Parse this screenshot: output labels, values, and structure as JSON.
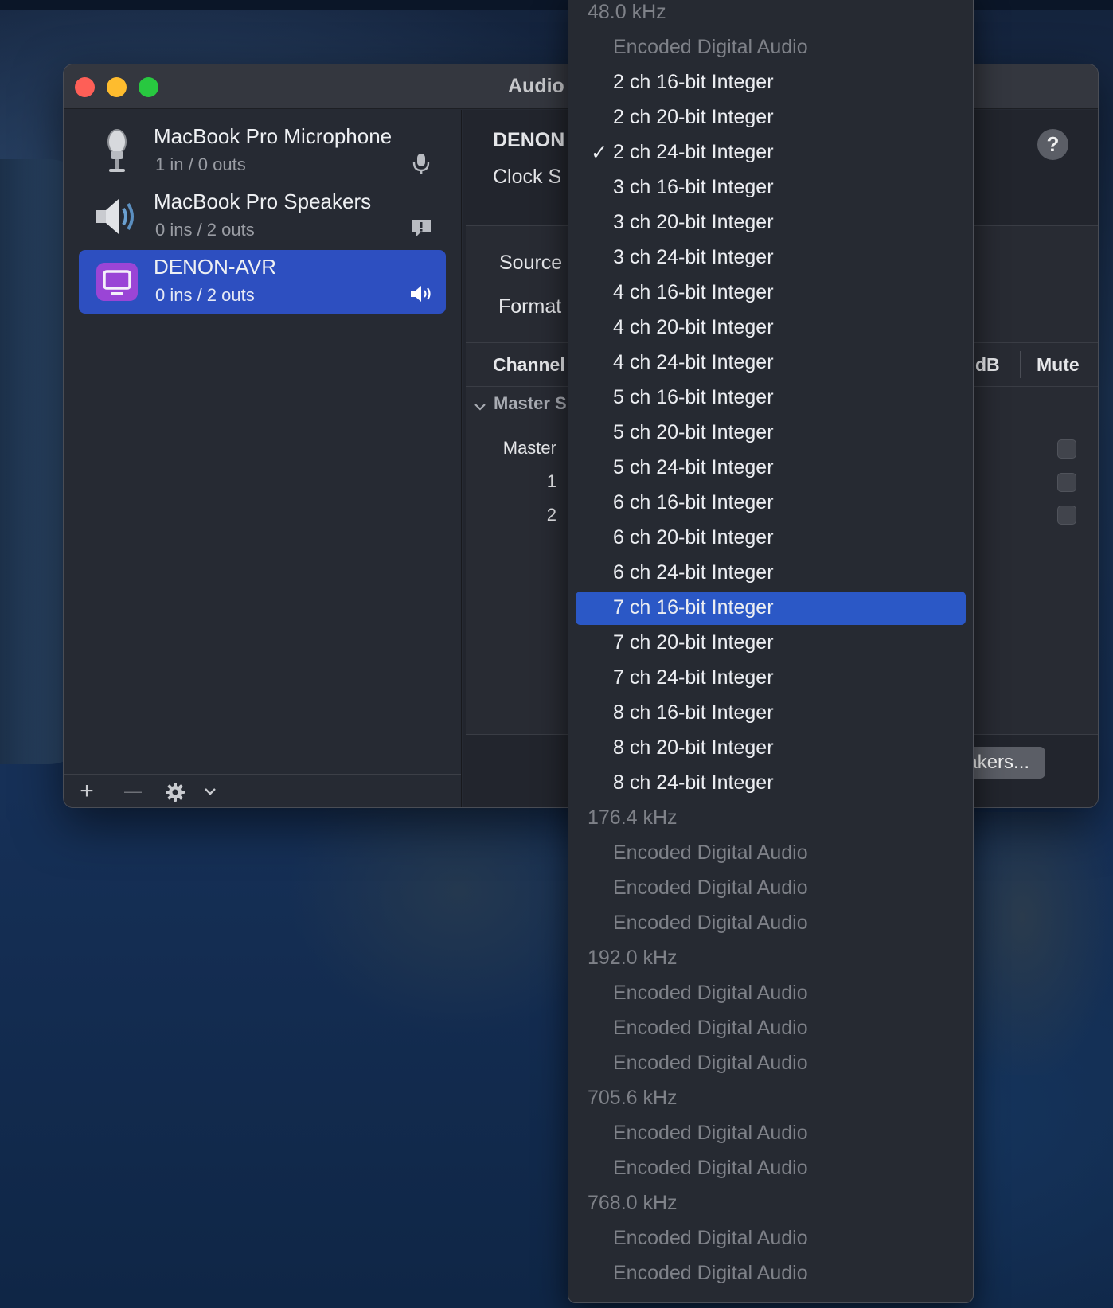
{
  "window": {
    "title": "Audio"
  },
  "sidebar": {
    "devices": [
      {
        "name": "MacBook Pro Microphone",
        "io": "1 in / 0 outs",
        "icon": "microphone-icon",
        "badge": "mic-input-icon"
      },
      {
        "name": "MacBook Pro Speakers",
        "io": "0 ins / 2 outs",
        "icon": "speaker-icon",
        "badge": "alert-bubble-icon"
      },
      {
        "name": "DENON-AVR",
        "io": "0 ins / 2 outs",
        "icon": "display-device-icon",
        "badge": "volume-icon",
        "selected": true
      }
    ],
    "footer": {
      "add": "+",
      "remove": "—"
    }
  },
  "detail": {
    "device_title": "DENON",
    "clock_label": "Clock S",
    "help": "?",
    "source_label": "Source",
    "format_label": "Format",
    "table": {
      "channel_header": "Channel",
      "db_header": "dB",
      "mute_header": "Mute",
      "group": "Master S",
      "rows": [
        "Master",
        "1",
        "2"
      ]
    },
    "configure_button": "eakers..."
  },
  "format_menu": {
    "colors": {
      "selected_bg": "#2b58c6",
      "disabled_text": "#7e8188"
    },
    "items": [
      {
        "text": "48.0 kHz",
        "kind": "header"
      },
      {
        "text": "Encoded Digital Audio",
        "kind": "disabled"
      },
      {
        "text": "2 ch 16-bit Integer",
        "kind": "option"
      },
      {
        "text": "2 ch 20-bit Integer",
        "kind": "option"
      },
      {
        "text": "2 ch 24-bit Integer",
        "kind": "option",
        "checked": true
      },
      {
        "text": "3 ch 16-bit Integer",
        "kind": "option"
      },
      {
        "text": "3 ch 20-bit Integer",
        "kind": "option"
      },
      {
        "text": "3 ch 24-bit Integer",
        "kind": "option"
      },
      {
        "text": "4 ch 16-bit Integer",
        "kind": "option"
      },
      {
        "text": "4 ch 20-bit Integer",
        "kind": "option"
      },
      {
        "text": "4 ch 24-bit Integer",
        "kind": "option"
      },
      {
        "text": "5 ch 16-bit Integer",
        "kind": "option"
      },
      {
        "text": "5 ch 20-bit Integer",
        "kind": "option"
      },
      {
        "text": "5 ch 24-bit Integer",
        "kind": "option"
      },
      {
        "text": "6 ch 16-bit Integer",
        "kind": "option"
      },
      {
        "text": "6 ch 20-bit Integer",
        "kind": "option"
      },
      {
        "text": "6 ch 24-bit Integer",
        "kind": "option"
      },
      {
        "text": "7 ch 16-bit Integer",
        "kind": "option",
        "highlighted": true
      },
      {
        "text": "7 ch 20-bit Integer",
        "kind": "option"
      },
      {
        "text": "7 ch 24-bit Integer",
        "kind": "option"
      },
      {
        "text": "8 ch 16-bit Integer",
        "kind": "option"
      },
      {
        "text": "8 ch 20-bit Integer",
        "kind": "option"
      },
      {
        "text": "8 ch 24-bit Integer",
        "kind": "option"
      },
      {
        "text": "176.4 kHz",
        "kind": "header"
      },
      {
        "text": "Encoded Digital Audio",
        "kind": "disabled"
      },
      {
        "text": "Encoded Digital Audio",
        "kind": "disabled"
      },
      {
        "text": "Encoded Digital Audio",
        "kind": "disabled"
      },
      {
        "text": "192.0 kHz",
        "kind": "header"
      },
      {
        "text": "Encoded Digital Audio",
        "kind": "disabled"
      },
      {
        "text": "Encoded Digital Audio",
        "kind": "disabled"
      },
      {
        "text": "Encoded Digital Audio",
        "kind": "disabled"
      },
      {
        "text": "705.6 kHz",
        "kind": "header"
      },
      {
        "text": "Encoded Digital Audio",
        "kind": "disabled"
      },
      {
        "text": "Encoded Digital Audio",
        "kind": "disabled"
      },
      {
        "text": "768.0 kHz",
        "kind": "header"
      },
      {
        "text": "Encoded Digital Audio",
        "kind": "disabled"
      },
      {
        "text": "Encoded Digital Audio",
        "kind": "disabled"
      }
    ]
  }
}
